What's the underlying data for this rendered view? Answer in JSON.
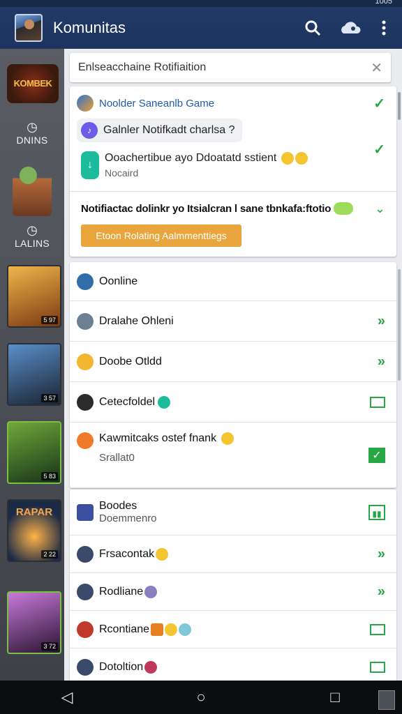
{
  "statusbar": {
    "right_text": "1005"
  },
  "appbar": {
    "title": "Komunitas"
  },
  "sidebar": {
    "logo_text": "KOMBEK",
    "block1_label": "DNINS",
    "block2_label": "LALINS",
    "thumbs": [
      {
        "badge": "5 97",
        "title": ""
      },
      {
        "badge": "3 57",
        "title": ""
      },
      {
        "badge": "5 83",
        "title": ""
      },
      {
        "badge": "2 22",
        "title": "RAPAR"
      },
      {
        "badge": "3 72",
        "title": ""
      }
    ]
  },
  "search": {
    "value": "Enlseacchaine Rotifiaition"
  },
  "notif": {
    "row1": "Noolder Saneanlb Game",
    "chip": "Galnler Notifkadt charlsa ?",
    "row3_title": "Ooachertibue ayo Ddoatatd sstient",
    "row3_sub": "Nocaird",
    "row4": "Notifiactac dolinkr yo Itsialcran l sane tbnkafa:ftotio",
    "button": "Etoon Rolating Aalmmenttiegs"
  },
  "list": [
    {
      "label": "Oonline",
      "control": "none",
      "color": "#2f6ea8"
    },
    {
      "label": "Dralahe Ohleni",
      "control": "chevron",
      "color": "#6b7f95"
    },
    {
      "label": "Doobe Otldd",
      "control": "chevron",
      "color": "#f2b631"
    },
    {
      "label": "Cetecfoldel",
      "control": "box",
      "color": "#2b2b2b"
    },
    {
      "label": "Kawmitcaks ostef fnank",
      "sub": "Srallat0",
      "control": "checked",
      "color": "#f07a2a"
    }
  ],
  "list2": [
    {
      "label": "Boodes",
      "sub": "Doemmenro",
      "control": "chart",
      "color": "#3a4fa0"
    },
    {
      "label": "Frsacontak",
      "control": "chevron",
      "color": "#3a4a6a"
    },
    {
      "label": "Rodliane",
      "control": "chevron",
      "color": "#3a4a6a"
    },
    {
      "label": "Rcontiane",
      "control": "box",
      "color": "#c0392b"
    },
    {
      "label": "Dotoltion",
      "control": "box",
      "color": "#3a4a6a"
    }
  ],
  "colors": {
    "accent": "#28a745",
    "appbar": "#213a66",
    "orange": "#e9a53c"
  }
}
